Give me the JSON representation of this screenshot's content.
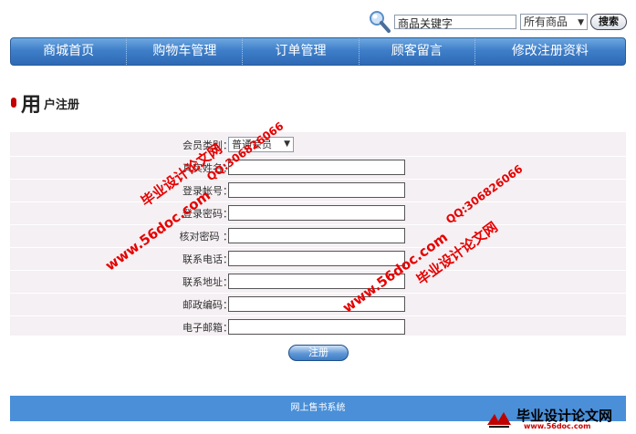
{
  "search": {
    "keyword": "商品关键字",
    "category": "所有商品",
    "button_label": "搜索"
  },
  "nav": {
    "items": [
      "商城首页",
      "购物车管理",
      "订单管理",
      "顾客留言",
      "修改注册资料"
    ]
  },
  "page": {
    "title_big": "用",
    "title_small": "户注册"
  },
  "form": {
    "member_type_label": "会员类别：",
    "member_type_value": "普通会员",
    "fields": [
      {
        "label": "真实姓名："
      },
      {
        "label": "登录帐号："
      },
      {
        "label": "登录密码："
      },
      {
        "label": "核对密码 ："
      },
      {
        "label": "联系电话："
      },
      {
        "label": "联系地址："
      },
      {
        "label": "邮政编码："
      },
      {
        "label": "电子邮箱："
      }
    ],
    "submit_label": "注册"
  },
  "footer": {
    "text": "网上售书系统"
  },
  "watermarks": {
    "site_name": "毕业设计论文网",
    "url": "www.56doc.com",
    "qq": "QQ:306826066"
  },
  "logo": {
    "name": "毕业设计论文网",
    "url": "www.56doc.com"
  },
  "colors": {
    "nav": "#3f7fc9",
    "footer": "#4a8fd8",
    "form_bg": "#f5f0f3",
    "watermark": "#e60000"
  }
}
